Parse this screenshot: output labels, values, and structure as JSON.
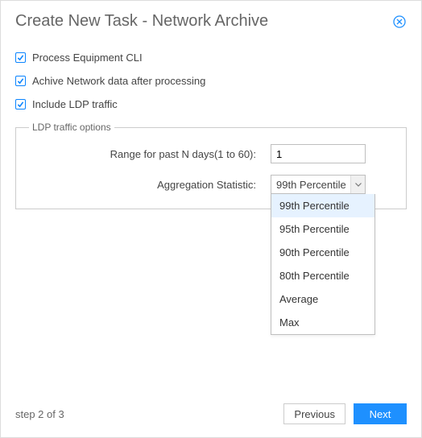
{
  "header": {
    "title": "Create New Task - Network Archive"
  },
  "checkboxes": {
    "process_equipment": {
      "label": "Process Equipment CLI",
      "checked": true
    },
    "archive_network": {
      "label": "Achive Network data after processing",
      "checked": true
    },
    "include_ldp": {
      "label": "Include LDP traffic",
      "checked": true
    }
  },
  "ldp_group": {
    "legend": "LDP traffic options",
    "range_label": "Range for past N days(1 to 60):",
    "range_value": "1",
    "agg_label": "Aggregation Statistic:",
    "agg_selected": "99th Percentile",
    "agg_options": [
      "99th Percentile",
      "95th Percentile",
      "90th Percentile",
      "80th Percentile",
      "Average",
      "Max"
    ]
  },
  "footer": {
    "step": "step 2 of 3",
    "previous": "Previous",
    "next": "Next"
  }
}
